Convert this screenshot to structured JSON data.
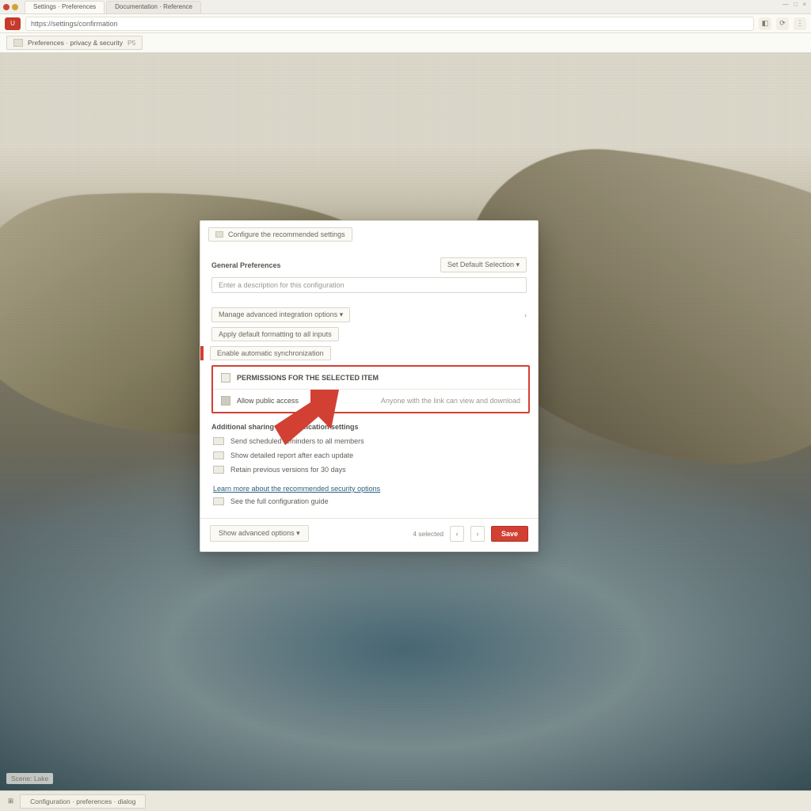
{
  "colors": {
    "accent_red": "#d24033",
    "accent_red_border": "#b23226"
  },
  "browser": {
    "tabs": [
      {
        "label": "Settings · Preferences"
      },
      {
        "label": "Documentation · Reference"
      }
    ],
    "syswin_glyph": "— □ ×",
    "url_badge": "U",
    "url_text": "https://settings/confirmation",
    "tool_icons": {
      "shield": "◧",
      "refresh": "⟳",
      "menu": "⋮"
    },
    "bookmark_chip": "Preferences · privacy & security",
    "bookmark_tag": "P5"
  },
  "dialog": {
    "top_chip": "Configure the recommended settings",
    "section1": {
      "label": "General Preferences",
      "button": "Set Default Selection ▾",
      "placeholder": "Enter a description for this configuration"
    },
    "row_a": {
      "chip": "Manage advanced integration options ▾",
      "caret": "›"
    },
    "row_b": {
      "chip": "Apply default formatting to all inputs"
    },
    "row_c": {
      "chip": "Enable automatic synchronization"
    },
    "highlight": {
      "line1": "PERMISSIONS FOR THE SELECTED ITEM",
      "line2_left": "Allow public access",
      "line2_right": "Anyone with the link can view and download"
    },
    "below_heading": "Additional sharing and notification settings",
    "items": [
      "Send scheduled reminders to all members",
      "Show detailed report after each update",
      "Retain previous versions for 30 days"
    ],
    "link": "Learn more about the recommended security options",
    "link_sub": "See the full configuration guide"
  },
  "footer": {
    "left": "Show advanced options ▾",
    "meta": "4 selected",
    "page_prev": "‹",
    "page_next": "›",
    "primary": "Save"
  },
  "desktop_label": "Scene: Lake",
  "taskbar": {
    "start": "⊞",
    "app": "Configuration · preferences · dialog"
  }
}
